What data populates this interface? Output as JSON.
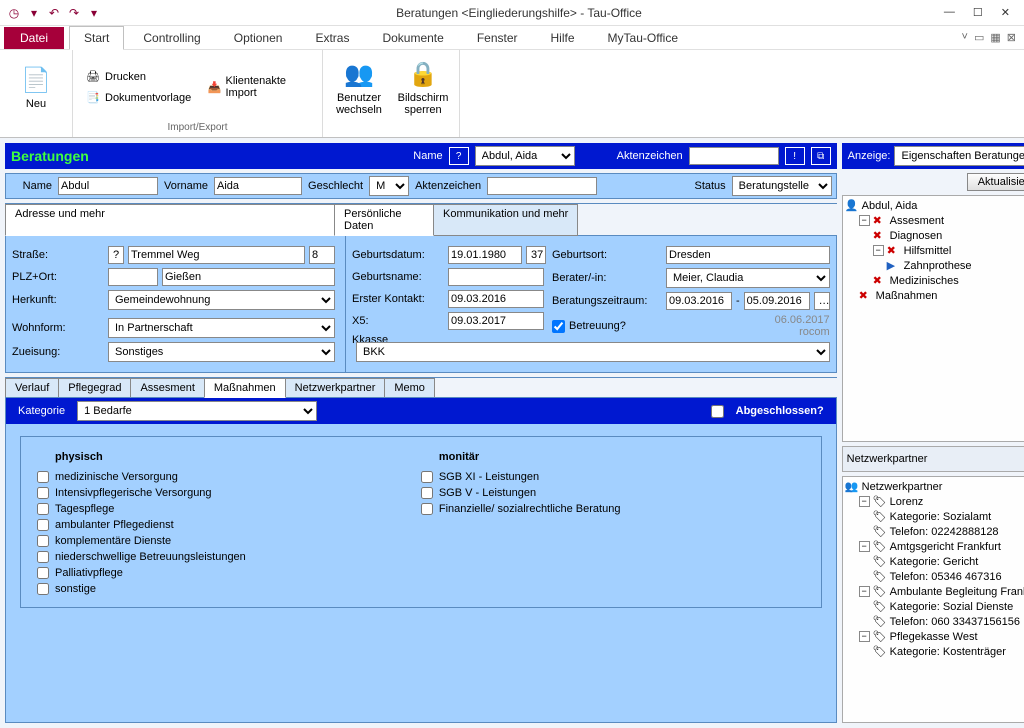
{
  "window": {
    "title": "Beratungen <Eingliederungshilfe>  -  Tau-Office"
  },
  "menu": {
    "file": "Datei",
    "tabs": [
      "Start",
      "Controlling",
      "Optionen",
      "Extras",
      "Dokumente",
      "Fenster",
      "Hilfe",
      "MyTau-Office"
    ]
  },
  "ribbon": {
    "neu": "Neu",
    "drucken": "Drucken",
    "dokumentvorlage": "Dokumentvorlage",
    "klientenakte_import": "Klientenakte Import",
    "import_export": "Import/Export",
    "benutzer_wechseln": "Benutzer\nwechseln",
    "bildschirm_sperren": "Bildschirm\nsperren"
  },
  "header": {
    "title": "Beratungen",
    "name_lbl": "Name",
    "name_val": "Abdul, Aida",
    "akten_lbl": "Aktenzeichen",
    "akten_val": ""
  },
  "anzeige": {
    "lbl": "Anzeige:",
    "val": "Eigenschaften Beratungen",
    "btn": "Aktualisieren"
  },
  "person": {
    "name_lbl": "Name",
    "name": "Abdul",
    "vorname_lbl": "Vorname",
    "vorname": "Aida",
    "geschlecht_lbl": "Geschlecht",
    "geschlecht": "M",
    "akten_lbl": "Aktenzeichen",
    "akten": "",
    "status_lbl": "Status",
    "status": "Beratungstelle"
  },
  "subtabs1": [
    "Adresse und mehr",
    "Persönliche Daten",
    "Kommunikation und mehr"
  ],
  "adresse": {
    "strasse_lbl": "Straße:",
    "strasse": "Tremmel Weg",
    "hausnr": "8",
    "plzort_lbl": "PLZ+Ort:",
    "plz": "",
    "ort": "Gießen",
    "herkunft_lbl": "Herkunft:",
    "herkunft": "Gemeindewohnung",
    "wohnform_lbl": "Wohnform:",
    "wohnform": "In Partnerschaft",
    "zueisung_lbl": "Zueisung:",
    "zueisung": "Sonstiges"
  },
  "persdaten": {
    "geb_lbl": "Geburtsdatum:",
    "geb": "19.01.1980",
    "age": "37",
    "gebort_lbl": "Geburtsort:",
    "gebort": "Dresden",
    "gebname_lbl": "Geburtsname:",
    "gebname": "",
    "berater_lbl": "Berater/-in:",
    "berater": "Meier, Claudia",
    "kontakt_lbl": "Erster Kontakt:",
    "kontakt": "09.03.2016",
    "zeitraum_lbl": "Beratungszeitraum:",
    "zeit_von": "09.03.2016",
    "zeit_bis": "05.09.2016",
    "x5_lbl": "X5:",
    "x5": "09.03.2017",
    "betreuung_lbl": "Betreuung?",
    "betreuung": true,
    "meta1": "06.06.2017",
    "meta2": "rocom",
    "kkasse_lbl": "Kkasse",
    "kkasse": "BKK"
  },
  "subtabs2": [
    "Verlauf",
    "Pflegegrad",
    "Assesment",
    "Maßnahmen",
    "Netzwerkpartner",
    "Memo"
  ],
  "massnahmen": {
    "kat_lbl": "Kategorie",
    "kat": "1 Bedarfe",
    "abg_lbl": "Abgeschlossen?",
    "col1": "physisch",
    "col2": "monitär",
    "phys": [
      "medizinische Versorgung",
      "Intensivpflegerische Versorgung",
      "Tagespflege",
      "ambulanter Pflegedienst",
      "komplementäre Dienste",
      "niederschwellige Betreuungsleistungen",
      "Palliativpflege",
      "sonstige"
    ],
    "mon": [
      "SGB XI - Leistungen",
      "SGB V - Leistungen",
      "Finanzielle/ sozialrechtliche Beratung"
    ]
  },
  "tree1": {
    "root": "Abdul, Aida",
    "n1": "Assesment",
    "n1a": "Diagnosen",
    "n1b": "Hilfsmittel",
    "n1b1": "Zahnprothese",
    "n1c": "Medizinisches",
    "n2": "Maßnahmen"
  },
  "netz": {
    "title": "Netzwerkpartner",
    "root": "Netzwerkpartner",
    "items": [
      {
        "name": "Lorenz",
        "kat": "Kategorie: Sozialamt",
        "tel": "Telefon: 02242888128"
      },
      {
        "name": "Amtgsgericht Frankfurt",
        "kat": "Kategorie: Gericht",
        "tel": "Telefon: 05346 467316"
      },
      {
        "name": "Ambulante Begleitung Frankfurt",
        "kat": "Kategorie: Sozial Dienste",
        "tel": "Telefon: 060 33437156156"
      },
      {
        "name": "Pflegekasse West",
        "kat": "Kategorie: Kostenträger"
      }
    ]
  }
}
